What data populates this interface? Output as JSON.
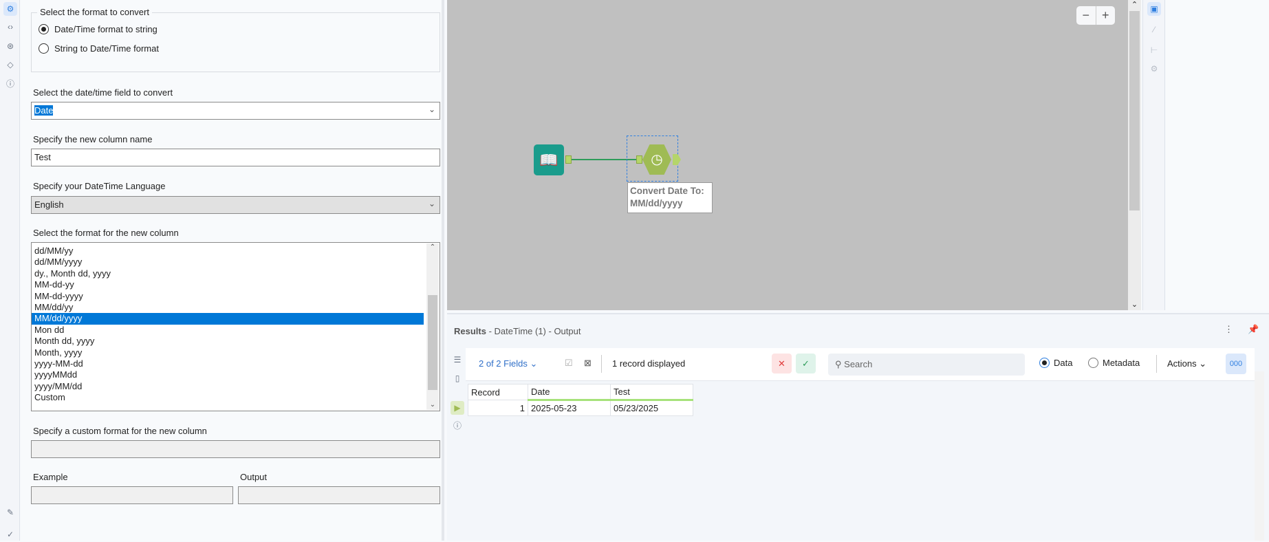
{
  "left_iconbar": {
    "icons": [
      "gear-icon",
      "code-icon",
      "connection-icon",
      "tag-icon",
      "help-icon"
    ],
    "bottom_icons": [
      "pencil-icon",
      "check-circle-icon"
    ]
  },
  "config": {
    "format_group": {
      "title": "Select the format to convert",
      "options": [
        "Date/Time format to string",
        "String to Date/Time format"
      ],
      "selected": 0
    },
    "field_label": "Select the date/time field to convert",
    "field_value": "Date",
    "column_label": "Specify the new column name",
    "column_value": "Test",
    "language_label": "Specify your DateTime Language",
    "language_value": "English",
    "format_label": "Select the format for the new column",
    "formats": [
      "dd/MM/yy",
      "dd/MM/yyyy",
      "dy., Month dd, yyyy",
      "MM-dd-yy",
      "MM-dd-yyyy",
      "MM/dd/yy",
      "MM/dd/yyyy",
      "Mon dd",
      "Month dd, yyyy",
      "Month, yyyy",
      "yyyy-MM-dd",
      "yyyyMMdd",
      "yyyy/MM/dd",
      "Custom"
    ],
    "selected_format": "MM/dd/yyyy",
    "custom_label": "Specify a custom format for the new column",
    "example_label": "Example",
    "output_label": "Output"
  },
  "canvas": {
    "zoom_out": "−",
    "zoom_in": "+",
    "tool_label": "Convert Date To:\nMM/dd/yyyy",
    "tool_label_1": "Convert Date To:",
    "tool_label_2": "MM/dd/yyyy"
  },
  "results": {
    "title": "Results",
    "subtitle": " - DateTime (1) - Output",
    "fields": "2 of 2 Fields",
    "records": "1 record displayed",
    "search_placeholder": "Search",
    "view_data": "Data",
    "view_metadata": "Metadata",
    "actions": "Actions",
    "cell_btn": "000",
    "columns": [
      "Record",
      "Date",
      "Test"
    ],
    "rows": [
      [
        "1",
        "2025-05-23",
        "05/23/2025"
      ]
    ]
  },
  "colors": {
    "accent": "#2f7fe0",
    "selection": "#0078d7",
    "canvas": "#c0c0c0",
    "input_tool": "#1a9c8c",
    "datetime_tool": "#9fbb54"
  }
}
